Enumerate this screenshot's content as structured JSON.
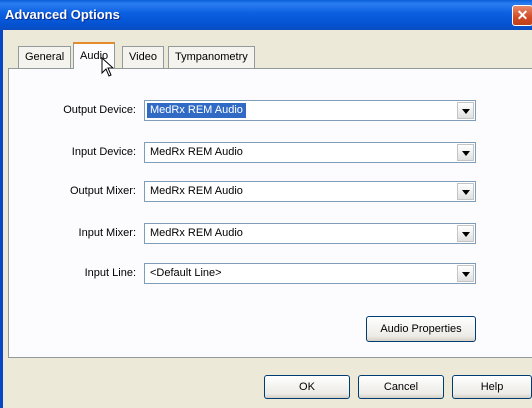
{
  "window": {
    "title": "Advanced Options",
    "close_glyph": "✕"
  },
  "tabs": [
    {
      "label": "General",
      "active": false
    },
    {
      "label": "Audio",
      "active": true
    },
    {
      "label": "Video",
      "active": false
    },
    {
      "label": "Tympanometry",
      "active": false
    }
  ],
  "form": {
    "output_device": {
      "label": "Output Device:",
      "value": "MedRx REM Audio"
    },
    "input_device": {
      "label": "Input Device:",
      "value": "MedRx REM Audio"
    },
    "output_mixer": {
      "label": "Output Mixer:",
      "value": "MedRx REM Audio"
    },
    "input_mixer": {
      "label": "Input Mixer:",
      "value": "MedRx REM Audio"
    },
    "input_line": {
      "label": "Input Line:",
      "value": "<Default Line>"
    }
  },
  "buttons": {
    "audio_properties": "Audio Properties",
    "ok": "OK",
    "cancel": "Cancel",
    "help": "Help"
  },
  "icons": {
    "cursor": "mouse-pointer-icon",
    "dropdown": "chevron-down-icon",
    "close": "close-icon"
  },
  "colors": {
    "title_bar": "#0453d2",
    "selection": "#316ac5",
    "dialog_bg": "#ece9d8"
  }
}
